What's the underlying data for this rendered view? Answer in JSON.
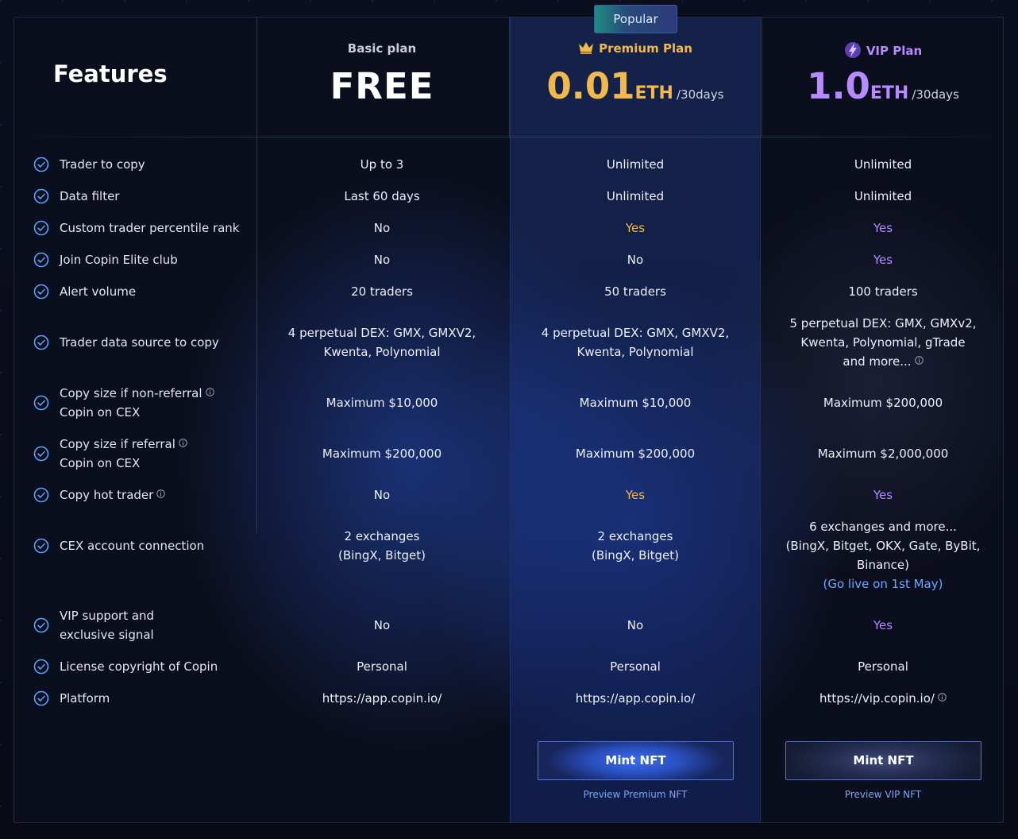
{
  "header": {
    "popular_badge": "Popular",
    "features_title": "Features",
    "basic": {
      "name": "Basic plan",
      "price": "FREE"
    },
    "premium": {
      "name": "Premium Plan",
      "amount": "0.01",
      "unit": "ETH",
      "period": "/30days"
    },
    "vip": {
      "name": "VIP Plan",
      "amount": "1.0",
      "unit": "ETH",
      "period": "/30days"
    }
  },
  "rows": [
    {
      "feature": "Trader to copy",
      "basic": "Up to 3",
      "premium": "Unlimited",
      "vip": "Unlimited"
    },
    {
      "feature": "Data filter",
      "basic": "Last 60 days",
      "premium": "Unlimited",
      "vip": "Unlimited"
    },
    {
      "feature": "Custom trader percentile rank",
      "basic": "No",
      "premium": "Yes",
      "vip": "Yes"
    },
    {
      "feature": "Join Copin Elite club",
      "basic": "No",
      "premium": "No",
      "vip": "Yes"
    },
    {
      "feature": "Alert volume",
      "basic": "20 traders",
      "premium": "50 traders",
      "vip": "100 traders"
    },
    {
      "feature": "Trader data source to copy",
      "basic_l1": "4 perpetual DEX: GMX, GMXV2,",
      "basic_l2": "Kwenta, Polynomial",
      "premium_l1": "4 perpetual DEX: GMX, GMXV2,",
      "premium_l2": "Kwenta, Polynomial",
      "vip_l1": "5 perpetual DEX: GMX, GMXv2,",
      "vip_l2": "Kwenta, Polynomial, gTrade",
      "vip_l3": "and more..."
    },
    {
      "feature_l1": "Copy size if non-referral",
      "feature_l2": "Copin on CEX",
      "basic": "Maximum $10,000",
      "premium": "Maximum $10,000",
      "vip": "Maximum $200,000"
    },
    {
      "feature_l1": "Copy size if referral",
      "feature_l2": "Copin on CEX",
      "basic": "Maximum $200,000",
      "premium": "Maximum $200,000",
      "vip": "Maximum $2,000,000"
    },
    {
      "feature": "Copy hot trader",
      "basic": "No",
      "premium": "Yes",
      "vip": "Yes"
    },
    {
      "feature": "CEX account connection",
      "basic_l1": "2 exchanges",
      "basic_l2": "(BingX, Bitget)",
      "premium_l1": "2 exchanges",
      "premium_l2": "(BingX, Bitget)",
      "vip_l1": "6 exchanges and more...",
      "vip_l2": "(BingX, Bitget, OKX, Gate, ByBit,",
      "vip_l3": "Binance)",
      "vip_l4": "(Go live on 1st May)"
    },
    {
      "feature_l1": "VIP support and",
      "feature_l2": "exclusive signal",
      "basic": "No",
      "premium": "No",
      "vip": "Yes"
    },
    {
      "feature": "License copyright of Copin",
      "basic": "Personal",
      "premium": "Personal",
      "vip": "Personal"
    },
    {
      "feature": "Platform",
      "basic": "https://app.copin.io/",
      "premium": "https://app.copin.io/",
      "vip": "https://vip.copin.io/"
    }
  ],
  "actions": {
    "premium_mint": "Mint NFT",
    "vip_mint": "Mint NFT",
    "premium_preview": "Preview Premium NFT",
    "vip_preview": "Preview VIP NFT"
  },
  "colors": {
    "gold": "#f2b84b",
    "purple": "#b78bff",
    "accent_blue": "#4a78e8"
  }
}
